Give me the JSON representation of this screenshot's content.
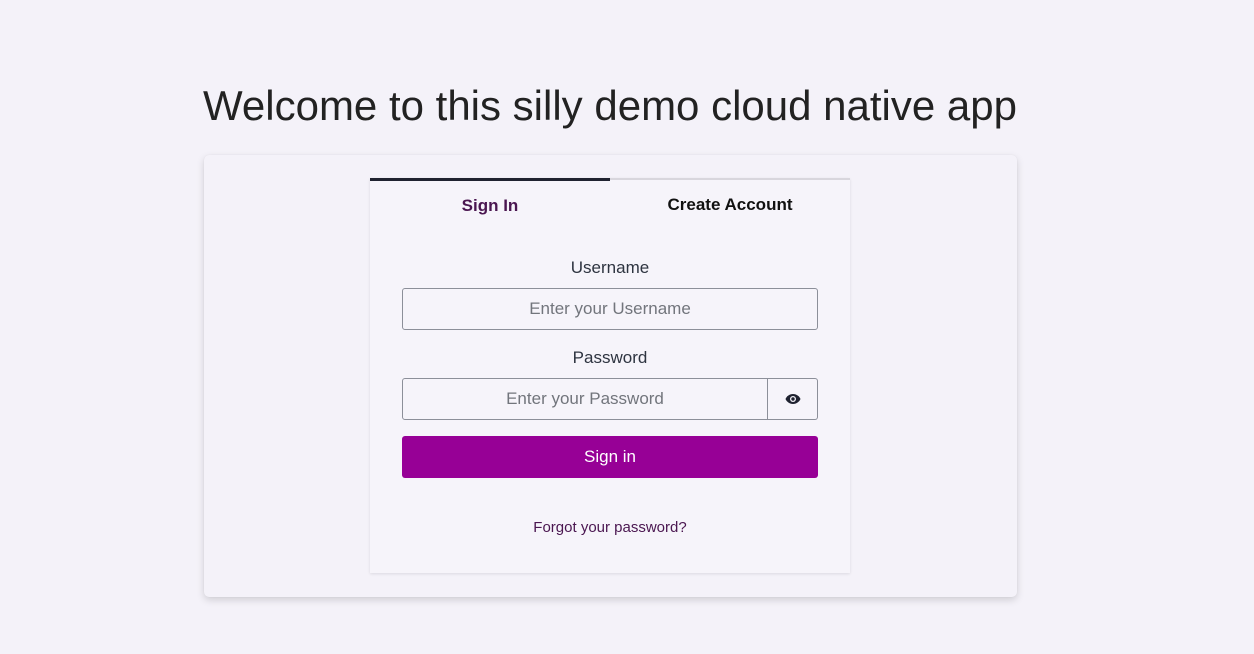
{
  "page": {
    "title": "Welcome to this silly demo cloud native app"
  },
  "tabs": [
    {
      "label": "Sign In",
      "active": true
    },
    {
      "label": "Create Account",
      "active": false
    }
  ],
  "form": {
    "username_label": "Username",
    "username_placeholder": "Enter your Username",
    "username_value": "",
    "password_label": "Password",
    "password_placeholder": "Enter your Password",
    "password_value": "",
    "show_password_icon": "eye-icon",
    "submit_label": "Sign in",
    "forgot_label": "Forgot your password?"
  },
  "colors": {
    "background": "#f4f2f9",
    "accent": "#970096",
    "link": "#4a1650",
    "active_tab_border": "#1f2230"
  }
}
